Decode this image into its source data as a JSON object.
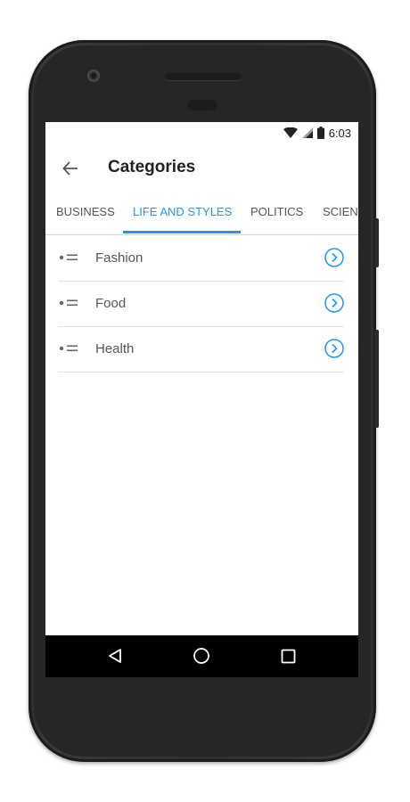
{
  "status_bar": {
    "time": "6:03",
    "icons": [
      "wifi-icon",
      "signal-icon",
      "battery-icon"
    ]
  },
  "app_bar": {
    "title": "Categories",
    "back_icon": "arrow-left-icon"
  },
  "tabs": [
    {
      "label": "BUSINESS",
      "active": false
    },
    {
      "label": "LIFE AND STYLES",
      "active": true
    },
    {
      "label": "POLITICS",
      "active": false
    },
    {
      "label": "SCIEN",
      "active": false
    }
  ],
  "categories": [
    {
      "label": "Fashion",
      "icon": "list-bullet-icon",
      "action_icon": "chevron-right-circle-icon"
    },
    {
      "label": "Food",
      "icon": "list-bullet-icon",
      "action_icon": "chevron-right-circle-icon"
    },
    {
      "label": "Health",
      "icon": "list-bullet-icon",
      "action_icon": "chevron-right-circle-icon"
    }
  ],
  "nav_bar": {
    "buttons": [
      "back-triangle-icon",
      "home-circle-icon",
      "recents-square-icon"
    ]
  },
  "colors": {
    "accent": "#2196f3",
    "text_primary": "#222222",
    "text_secondary": "#555555",
    "divider": "#e3e3e3",
    "nav_bar": "#000000"
  }
}
